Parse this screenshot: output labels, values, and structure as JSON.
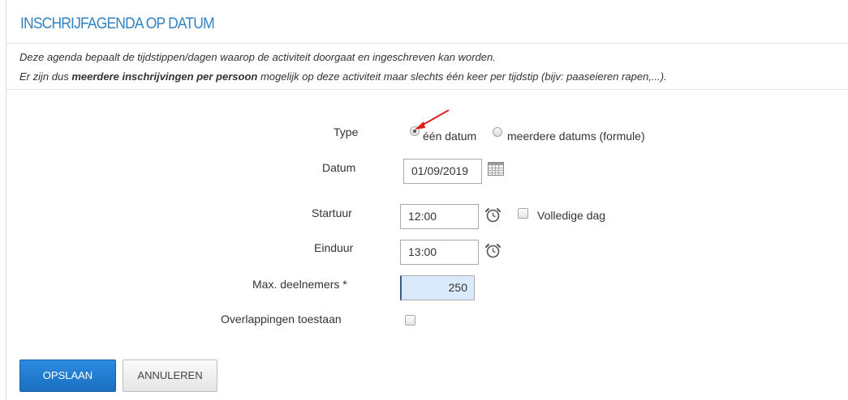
{
  "section": {
    "title": "INSCHRIJFAGENDA OP DATUM"
  },
  "intro": {
    "line1": "Deze agenda bepaalt de tijdstippen/dagen waarop de activiteit doorgaat en ingeschreven kan worden.",
    "line2_prefix": "Er zijn dus ",
    "line2_bold": "meerdere inschrijvingen per persoon",
    "line2_suffix": " mogelijk op deze activiteit maar slechts één keer per tijdstip (bijv: paaseieren rapen,...)."
  },
  "form": {
    "type": {
      "label": "Type",
      "options": [
        {
          "label": "één datum",
          "checked": true
        },
        {
          "label": "meerdere datums (formule)",
          "checked": false
        }
      ]
    },
    "datum": {
      "label": "Datum",
      "value": "01/09/2019",
      "icon": "calendar-icon"
    },
    "startuur": {
      "label": "Startuur",
      "value": "12:00",
      "icon": "alarm-clock-icon"
    },
    "volledige_dag": {
      "label": "Volledige dag",
      "checked": false
    },
    "einduur": {
      "label": "Einduur",
      "value": "13:00",
      "icon": "alarm-clock-icon"
    },
    "max_deelnemers": {
      "label": "Max. deelnemers *",
      "value": "250"
    },
    "overlappingen": {
      "label": "Overlappingen toestaan",
      "checked": false
    }
  },
  "buttons": {
    "save": "OPSLAAN",
    "cancel": "ANNULEREN"
  },
  "colors": {
    "accent": "#2f82c4",
    "primary_button": "#1f77cf",
    "highlight_input": "#dbeafb",
    "annotation_arrow": "#e02020"
  }
}
